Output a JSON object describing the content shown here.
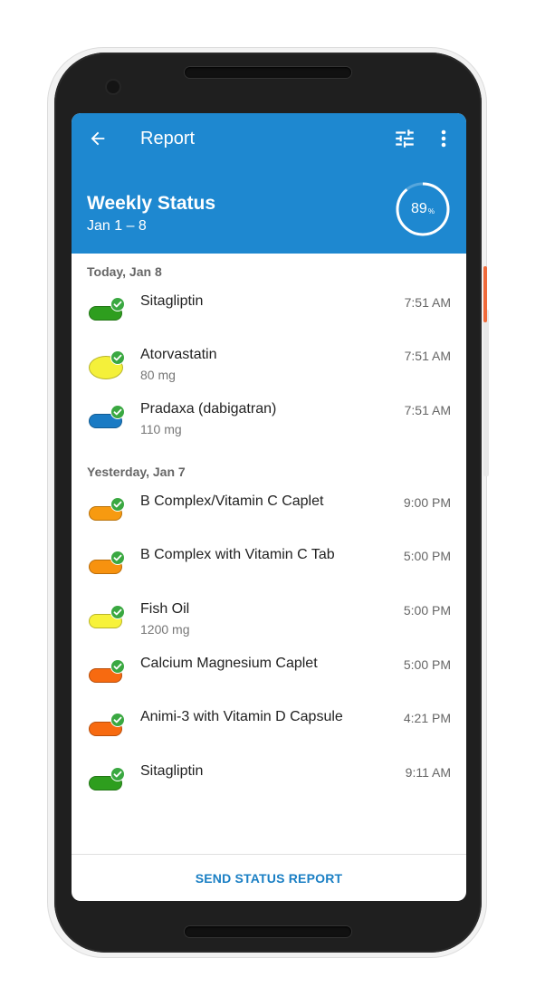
{
  "header": {
    "title": "Report",
    "back_icon": "arrow-back-icon",
    "filter_icon": "tune-icon",
    "menu_icon": "more-vert-icon"
  },
  "status": {
    "title": "Weekly Status",
    "range": "Jan 1 – 8",
    "percent": "89",
    "percent_sign": "%",
    "progress_fraction": 0.89
  },
  "sections": [
    {
      "label": "Today, Jan 8",
      "items": [
        {
          "name": "Sitagliptin",
          "dose": "",
          "time": "7:51 AM",
          "color": "#2e9e1e",
          "shape": "capsule"
        },
        {
          "name": "Atorvastatin",
          "dose": "80 mg",
          "time": "7:51 AM",
          "color": "#f4f03a",
          "shape": "oval"
        },
        {
          "name": "Pradaxa (dabigatran)",
          "dose": "110 mg",
          "time": "7:51 AM",
          "color": "#1a7bc4",
          "shape": "capsule"
        }
      ]
    },
    {
      "label": "Yesterday, Jan 7",
      "items": [
        {
          "name": "B Complex/Vitamin C Caplet",
          "dose": "",
          "time": "9:00 PM",
          "color": "#f79a10",
          "shape": "capsule"
        },
        {
          "name": "B Complex with Vitamin C Tab",
          "dose": "",
          "time": "5:00 PM",
          "color": "#f7920f",
          "shape": "capsule"
        },
        {
          "name": "Fish Oil",
          "dose": "1200 mg",
          "time": "5:00 PM",
          "color": "#f7f23a",
          "shape": "capsule"
        },
        {
          "name": "Calcium Magnesium Caplet",
          "dose": "",
          "time": "5:00 PM",
          "color": "#f76a10",
          "shape": "capsule"
        },
        {
          "name": "Animi-3 with Vitamin D Capsule",
          "dose": "",
          "time": "4:21 PM",
          "color": "#f76a10",
          "shape": "capsule"
        },
        {
          "name": "Sitagliptin",
          "dose": "",
          "time": "9:11 AM",
          "color": "#2e9e1e",
          "shape": "capsule"
        }
      ]
    }
  ],
  "footer": {
    "send_label": "SEND STATUS REPORT"
  },
  "colors": {
    "appbar": "#1e88d0",
    "accent": "#1a7fc4",
    "check": "#3aa841"
  }
}
